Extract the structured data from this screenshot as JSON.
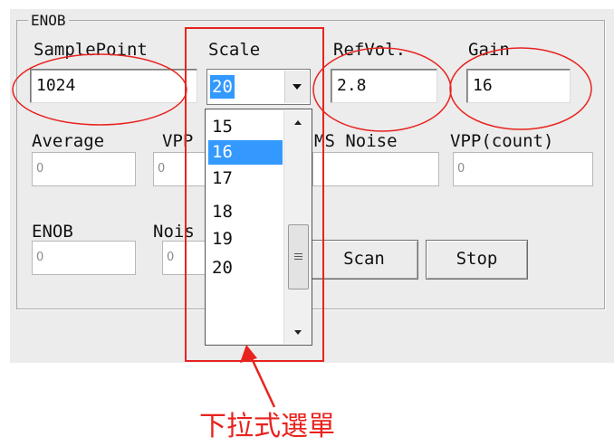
{
  "group": {
    "title": "ENOB"
  },
  "labels": {
    "sample_point": "SamplePoint",
    "scale": "Scale",
    "ref_vol": "RefVol.",
    "gain": "Gain",
    "average": "Average",
    "vpp": "VPP",
    "rms_noise": "MS Noise",
    "vpp_count": "VPP(count)",
    "enob": "ENOB",
    "noise": "Nois"
  },
  "inputs": {
    "sample_point": "1024",
    "ref_vol": "2.8",
    "gain": "16",
    "average": "0",
    "vpp": "0",
    "vpp_count": "0",
    "enob": "0",
    "noise": "0"
  },
  "scale_combo": {
    "selected": "20",
    "options": [
      "15",
      "16",
      "17",
      "18",
      "19",
      "20"
    ],
    "highlighted": "16"
  },
  "buttons": {
    "scan": "Scan",
    "stop": "Stop"
  },
  "annotation": {
    "caption": "下拉式選單",
    "color": "#e8231f"
  }
}
